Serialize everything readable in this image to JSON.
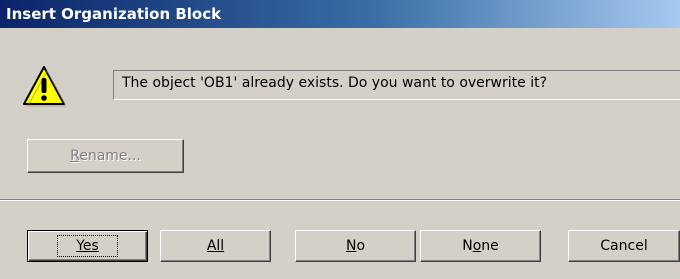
{
  "window": {
    "title": "Insert Organization Block"
  },
  "message": {
    "icon": "warning-icon",
    "text": "The object 'OB1' already exists. Do you want to overwrite it?"
  },
  "rename_button": {
    "label": "Rename...",
    "enabled": false
  },
  "buttons": {
    "yes": "Yes",
    "all": "All",
    "no": "No",
    "none": "None",
    "cancel": "Cancel"
  },
  "colors": {
    "dialog_bg": "#d4d0c8",
    "title_start": "#0a246a",
    "title_end": "#a6caf0",
    "warning_yellow": "#ffff00"
  }
}
